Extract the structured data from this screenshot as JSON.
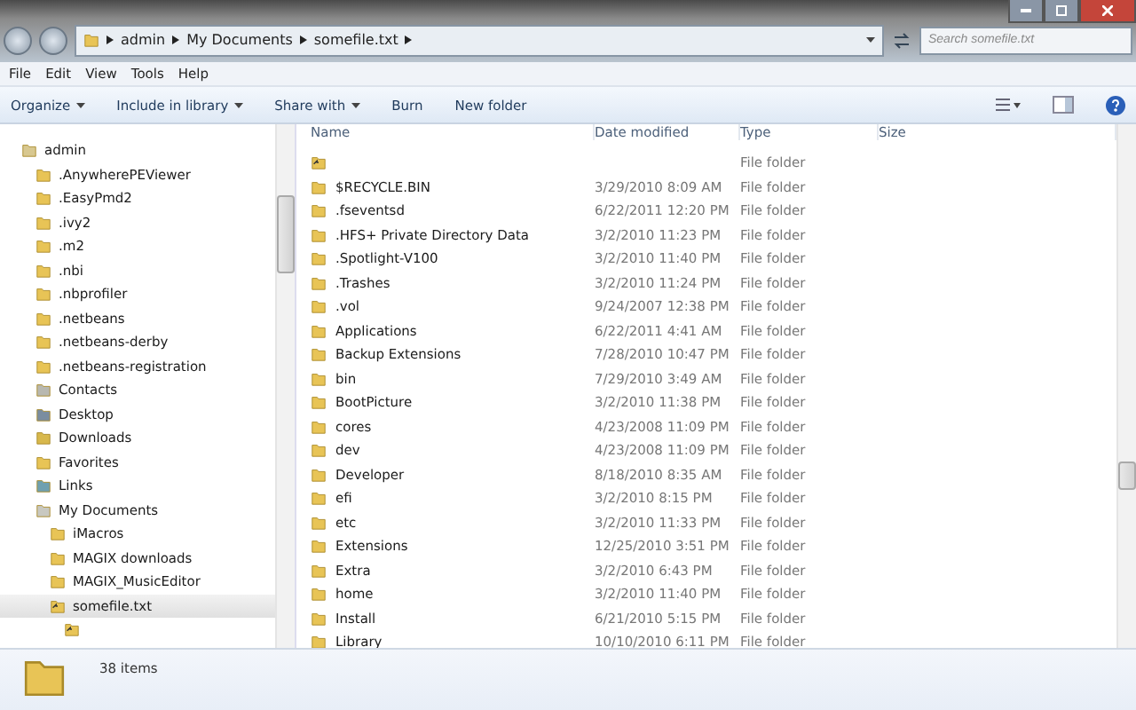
{
  "address": {
    "crumbs": [
      "admin",
      "My Documents",
      "somefile.txt"
    ]
  },
  "search": {
    "placeholder": "Search somefile.txt"
  },
  "menu": [
    "File",
    "Edit",
    "View",
    "Tools",
    "Help"
  ],
  "toolbar": [
    {
      "label": "Organize",
      "dropdown": true
    },
    {
      "label": "Include in library",
      "dropdown": true
    },
    {
      "label": "Share with",
      "dropdown": true
    },
    {
      "label": "Burn",
      "dropdown": false
    },
    {
      "label": "New folder",
      "dropdown": false
    }
  ],
  "tree": [
    {
      "label": "admin",
      "kind": "user",
      "selected": false,
      "children": [
        {
          "label": ".AnywherePEViewer",
          "kind": "folder",
          "selected": false
        },
        {
          "label": ".EasyPmd2",
          "kind": "folder",
          "selected": false
        },
        {
          "label": ".ivy2",
          "kind": "folder",
          "selected": false
        },
        {
          "label": ".m2",
          "kind": "folder",
          "selected": false
        },
        {
          "label": ".nbi",
          "kind": "folder",
          "selected": false
        },
        {
          "label": ".nbprofiler",
          "kind": "folder",
          "selected": false
        },
        {
          "label": ".netbeans",
          "kind": "folder",
          "selected": false
        },
        {
          "label": ".netbeans-derby",
          "kind": "folder",
          "selected": false
        },
        {
          "label": ".netbeans-registration",
          "kind": "folder",
          "selected": false
        },
        {
          "label": "Contacts",
          "kind": "contacts",
          "selected": false
        },
        {
          "label": "Desktop",
          "kind": "desktop",
          "selected": false
        },
        {
          "label": "Downloads",
          "kind": "downloads",
          "selected": false
        },
        {
          "label": "Favorites",
          "kind": "folder",
          "selected": false
        },
        {
          "label": "Links",
          "kind": "links",
          "selected": false
        },
        {
          "label": "My Documents",
          "kind": "documents",
          "selected": false,
          "children": [
            {
              "label": "iMacros",
              "kind": "folder",
              "selected": false
            },
            {
              "label": "MAGIX downloads",
              "kind": "folder",
              "selected": false
            },
            {
              "label": "MAGIX_MusicEditor",
              "kind": "folder",
              "selected": false
            },
            {
              "label": "somefile.txt",
              "kind": "shortcut",
              "selected": true,
              "children": [
                {
                  "kind": "shortcut",
                  "selected": false
                }
              ]
            }
          ]
        }
      ]
    }
  ],
  "columns": [
    "Name",
    "Date modified",
    "Type",
    "Size"
  ],
  "rows": [
    {
      "kind": "shortcut",
      "type": "File folder"
    },
    {
      "kind": "folder",
      "name": "$RECYCLE.BIN",
      "date": "3/29/2010 8:09 AM",
      "type": "File folder"
    },
    {
      "kind": "folder",
      "name": ".fseventsd",
      "date": "6/22/2011 12:20 PM",
      "type": "File folder"
    },
    {
      "kind": "folder",
      "name": ".HFS+ Private Directory Data",
      "date": "3/2/2010 11:23 PM",
      "type": "File folder"
    },
    {
      "kind": "folder",
      "name": ".Spotlight-V100",
      "date": "3/2/2010 11:40 PM",
      "type": "File folder"
    },
    {
      "kind": "folder",
      "name": ".Trashes",
      "date": "3/2/2010 11:24 PM",
      "type": "File folder"
    },
    {
      "kind": "folder",
      "name": ".vol",
      "date": "9/24/2007 12:38 PM",
      "type": "File folder"
    },
    {
      "kind": "folder",
      "name": "Applications",
      "date": "6/22/2011 4:41 AM",
      "type": "File folder"
    },
    {
      "kind": "folder",
      "name": "Backup Extensions",
      "date": "7/28/2010 10:47 PM",
      "type": "File folder"
    },
    {
      "kind": "folder",
      "name": "bin",
      "date": "7/29/2010 3:49 AM",
      "type": "File folder"
    },
    {
      "kind": "folder",
      "name": "BootPicture",
      "date": "3/2/2010 11:38 PM",
      "type": "File folder"
    },
    {
      "kind": "folder",
      "name": "cores",
      "date": "4/23/2008 11:09 PM",
      "type": "File folder"
    },
    {
      "kind": "folder",
      "name": "dev",
      "date": "4/23/2008 11:09 PM",
      "type": "File folder"
    },
    {
      "kind": "folder",
      "name": "Developer",
      "date": "8/18/2010 8:35 AM",
      "type": "File folder"
    },
    {
      "kind": "folder",
      "name": "efi",
      "date": "3/2/2010 8:15 PM",
      "type": "File folder"
    },
    {
      "kind": "folder",
      "name": "etc",
      "date": "3/2/2010 11:33 PM",
      "type": "File folder"
    },
    {
      "kind": "folder",
      "name": "Extensions",
      "date": "12/25/2010 3:51 PM",
      "type": "File folder"
    },
    {
      "kind": "folder",
      "name": "Extra",
      "date": "3/2/2010 6:43 PM",
      "type": "File folder"
    },
    {
      "kind": "folder",
      "name": "home",
      "date": "3/2/2010 11:40 PM",
      "type": "File folder"
    },
    {
      "kind": "folder",
      "name": "Install",
      "date": "6/21/2010 5:15 PM",
      "type": "File folder"
    },
    {
      "kind": "folder",
      "name": "Library",
      "date": "10/10/2010 6:11 PM",
      "type": "File folder"
    }
  ],
  "status": {
    "count": "38 items"
  }
}
